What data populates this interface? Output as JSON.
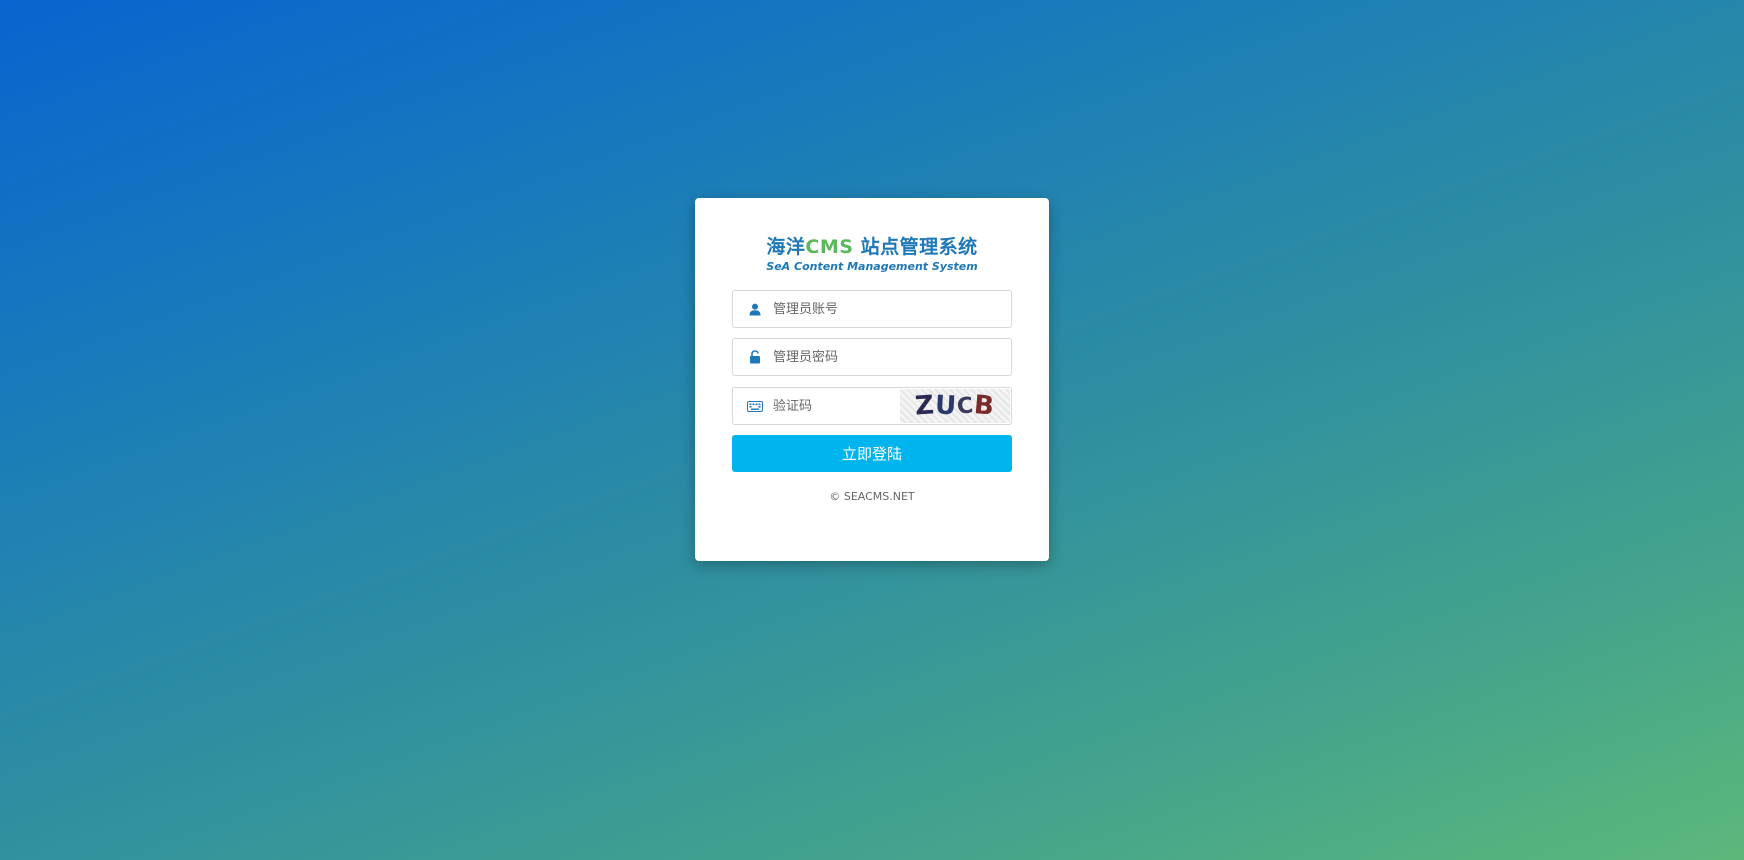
{
  "header": {
    "title_part1": "海洋",
    "title_cms": "CMS",
    "title_part2": " 站点管理系统",
    "subtitle": "SeA Content Management System"
  },
  "form": {
    "username_placeholder": "管理员账号",
    "password_placeholder": "管理员密码",
    "captcha_placeholder": "验证码",
    "captcha_text": [
      "Z",
      "U",
      "C",
      "B"
    ],
    "submit_label": "立即登陆"
  },
  "footer": {
    "copyright": "© SEACMS.NET"
  },
  "colors": {
    "brand_blue": "#1e78b8",
    "brand_green": "#5cb85c",
    "button": "#00b5ee"
  },
  "icons": {
    "username": "user-icon",
    "password": "unlock-icon",
    "captcha": "keyboard-icon"
  }
}
